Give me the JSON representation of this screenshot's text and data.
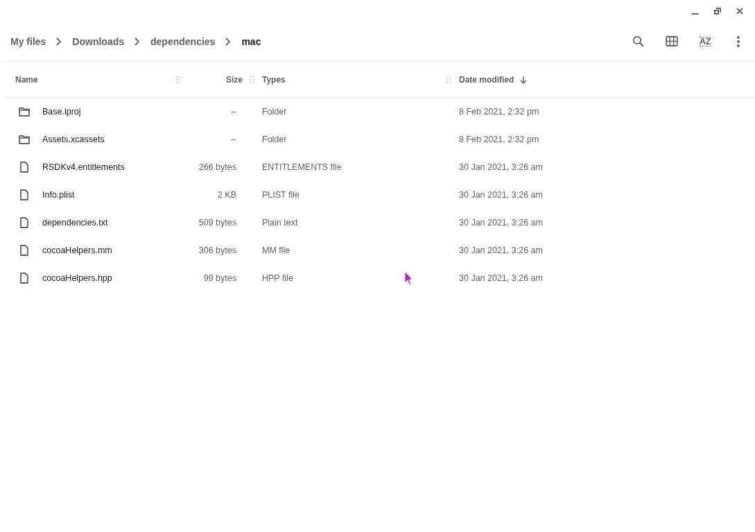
{
  "breadcrumb": [
    {
      "label": "My files",
      "current": false
    },
    {
      "label": "Downloads",
      "current": false
    },
    {
      "label": "dependencies",
      "current": false
    },
    {
      "label": "mac",
      "current": true
    }
  ],
  "toolbar": [
    {
      "kind": "search"
    },
    {
      "kind": "grid"
    },
    {
      "kind": "sort",
      "label": "AZ"
    },
    {
      "kind": "more"
    }
  ],
  "table": {
    "columns": [
      {
        "label": "Name",
        "sorted": false
      },
      {
        "label": "Size",
        "sorted": false
      },
      {
        "label": "Types",
        "sorted": false
      },
      {
        "label": "Date modified",
        "sorted": true
      }
    ],
    "rows": [
      {
        "kind": "folder",
        "name": "Base.lproj",
        "size": "--",
        "type": "Folder",
        "date": "8 Feb 2021, 2:32 pm"
      },
      {
        "kind": "folder",
        "name": "Assets.xcassets",
        "size": "--",
        "type": "Folder",
        "date": "8 Feb 2021, 2:32 pm"
      },
      {
        "kind": "file",
        "name": "RSDKv4.entitlements",
        "size": "266 bytes",
        "type": "ENTITLEMENTS file",
        "date": "30 Jan 2021, 3:26 am"
      },
      {
        "kind": "file",
        "name": "Info.plist",
        "size": "2 KB",
        "type": "PLIST file",
        "date": "30 Jan 2021, 3:26 am"
      },
      {
        "kind": "file",
        "name": "dependencies.txt",
        "size": "509 bytes",
        "type": "Plain text",
        "date": "30 Jan 2021, 3:26 am"
      },
      {
        "kind": "file",
        "name": "cocoaHelpers.mm",
        "size": "306 bytes",
        "type": "MM file",
        "date": "30 Jan 2021, 3:26 am"
      },
      {
        "kind": "file",
        "name": "cocoaHelpers.hpp",
        "size": "99 bytes",
        "type": "HPP file",
        "date": "30 Jan 2021, 3:26 am"
      }
    ]
  }
}
